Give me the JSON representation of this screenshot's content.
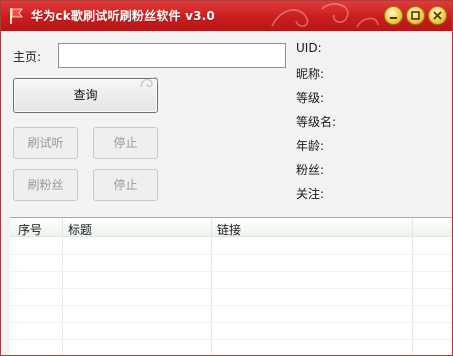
{
  "window": {
    "title": "华为ck歌刷试听刷粉丝软件 v3.0",
    "controls": [
      "minimize-icon",
      "maximize-icon",
      "close-icon"
    ]
  },
  "form": {
    "homepage_label": "主页:",
    "homepage_value": "",
    "query_button": "查询",
    "brush_listen_button": "刷试听",
    "stop_listen_button": "停止",
    "brush_fans_button": "刷粉丝",
    "stop_fans_button": "停止"
  },
  "info": {
    "uid_label": "UID:",
    "nickname_label": "昵称:",
    "level_label": "等级:",
    "level_name_label": "等级名:",
    "age_label": "年龄:",
    "fans_label": "粉丝:",
    "follow_label": "关注:"
  },
  "table": {
    "columns": [
      "序号",
      "标题",
      "链接"
    ],
    "rows": []
  },
  "colors": {
    "titlebar": "#c81d1d",
    "window_bg": "#f3f3f3",
    "button_disabled_text": "#9a9a9a"
  }
}
